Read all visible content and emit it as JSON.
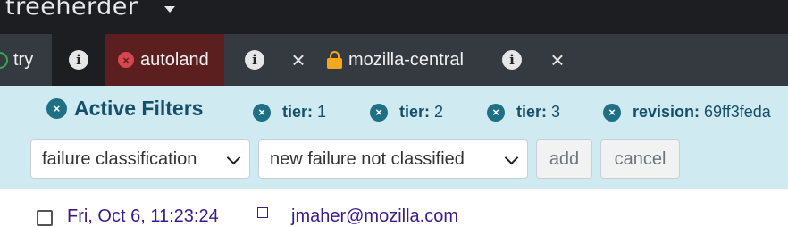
{
  "app": {
    "logo_text": "treeherder"
  },
  "repo_tabs": {
    "try": {
      "label": "try",
      "status": "open"
    },
    "autoland": {
      "label": "autoland",
      "status": "closed"
    },
    "mozilla_central": {
      "label": "mozilla-central",
      "status": "approval-required"
    },
    "info_glyph": "i",
    "close_glyph": "×",
    "closed_glyph": "×"
  },
  "active_filters": {
    "title": "Active Filters",
    "chips": [
      {
        "field": "tier:",
        "value": "1"
      },
      {
        "field": "tier:",
        "value": "2"
      },
      {
        "field": "tier:",
        "value": "3"
      },
      {
        "field": "revision:",
        "value": "69ff3feda"
      }
    ],
    "field_select": {
      "value": "failure classification"
    },
    "value_select": {
      "value": "new failure not classified"
    },
    "add_label": "add",
    "cancel_label": "cancel",
    "remove_glyph": "×"
  },
  "push": {
    "date": "Fri, Oct 6, 11:23:24",
    "author": "jmaher@mozilla.com"
  },
  "colors": {
    "navbar": "#1c1e21",
    "tabbar": "#343a40",
    "closed_tab": "#5c1f20",
    "filters_bg": "#d0eaf1",
    "filters_text": "#14506b",
    "lock": "#f4a81a",
    "open_ring": "#32a852"
  },
  "icons": [
    "caret-down-icon",
    "open-status-icon",
    "info-icon",
    "closed-status-icon",
    "close-icon",
    "lock-icon",
    "remove-filter-icon",
    "chevron-down-icon",
    "external-link-icon",
    "checkbox-icon"
  ]
}
